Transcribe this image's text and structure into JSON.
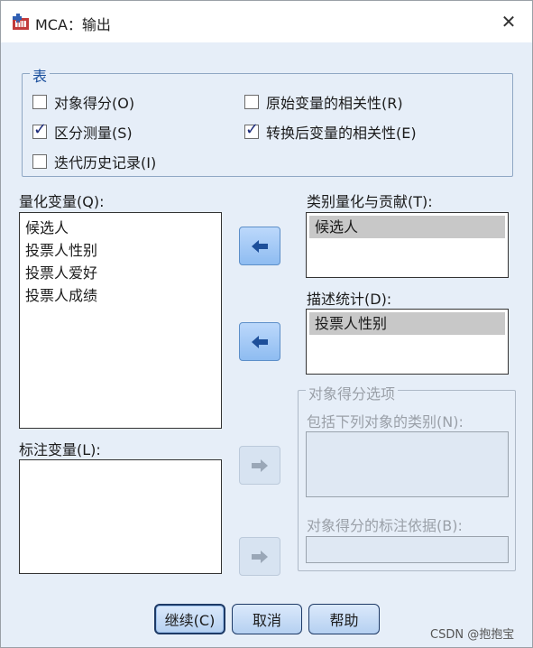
{
  "window": {
    "title": "MCA：输出",
    "close_glyph": "✕"
  },
  "tables_group": {
    "label": "表",
    "checkboxes": [
      {
        "label": "对象得分(O)",
        "checked": false
      },
      {
        "label": "区分测量(S)",
        "checked": true
      },
      {
        "label": "迭代历史记录(I)",
        "checked": false
      },
      {
        "label": "原始变量的相关性(R)",
        "checked": false
      },
      {
        "label": "转换后变量的相关性(E)",
        "checked": true
      }
    ]
  },
  "quantified_vars": {
    "label": "量化变量(Q):",
    "items": [
      "候选人",
      "投票人性别",
      "投票人爱好",
      "投票人成绩"
    ]
  },
  "labeling_vars": {
    "label": "标注变量(L):",
    "items": []
  },
  "category_quant": {
    "label": "类别量化与贡献(T):",
    "items": [
      "候选人"
    ]
  },
  "descriptive_stats": {
    "label": "描述统计(D):",
    "items": [
      "投票人性别"
    ]
  },
  "object_score_options": {
    "label": "对象得分选项",
    "include_label": "包括下列对象的类别(N):",
    "label_by_label": "对象得分的标注依据(B):"
  },
  "buttons": {
    "continue": "继续(C)",
    "cancel": "取消",
    "help": "帮助"
  },
  "watermark": "CSDN @抱抱宝",
  "colors": {
    "accent": "#1a4f9c",
    "window_bg": "#e6eef8"
  }
}
